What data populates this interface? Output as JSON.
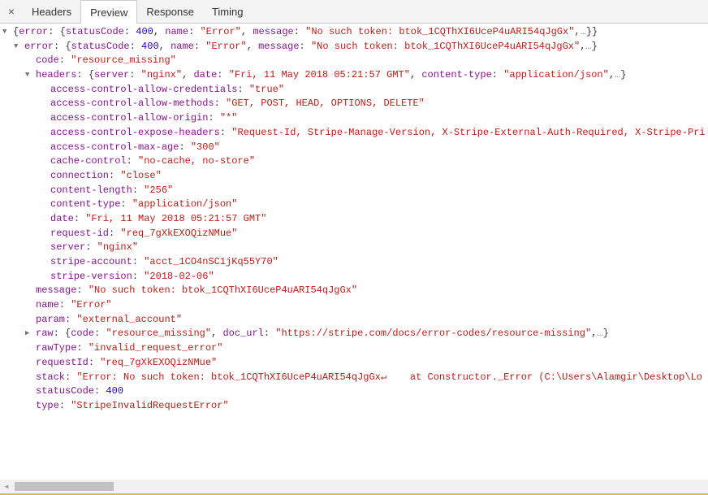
{
  "tabs": {
    "close_icon": "×",
    "items": [
      {
        "label": "Headers",
        "selected": false
      },
      {
        "label": "Preview",
        "selected": true
      },
      {
        "label": "Response",
        "selected": false
      },
      {
        "label": "Timing",
        "selected": false
      }
    ]
  },
  "colors": {
    "key": "#881391",
    "string": "#c41a16",
    "number": "#1c00cf",
    "punct": "#303942",
    "ellipsis": "#888888",
    "triangle": "#727272",
    "tabbar_bg": "#f3f3f3",
    "border": "#cccccc",
    "tab_text": "#333333",
    "scroll_track": "#f1f1f1",
    "scroll_thumb": "#c1c1c1",
    "bottom_line": "#ddb852"
  },
  "scrollbar": {
    "left_arrow": "◄"
  },
  "tree": {
    "rows": [
      {
        "l": 0,
        "a": "d",
        "s": [
          {
            "c": "p",
            "t": "{"
          },
          {
            "c": "k",
            "t": "error"
          },
          {
            "c": "p",
            "t": ": {"
          },
          {
            "c": "k",
            "t": "statusCode"
          },
          {
            "c": "p",
            "t": ": "
          },
          {
            "c": "n",
            "t": "400"
          },
          {
            "c": "p",
            "t": ", "
          },
          {
            "c": "k",
            "t": "name"
          },
          {
            "c": "p",
            "t": ": "
          },
          {
            "c": "s",
            "t": "\"Error\""
          },
          {
            "c": "p",
            "t": ", "
          },
          {
            "c": "k",
            "t": "message"
          },
          {
            "c": "p",
            "t": ": "
          },
          {
            "c": "s",
            "t": "\"No such token: btok_1CQThXI6UceP4uARI54qJgGx\""
          },
          {
            "c": "p",
            "t": ","
          },
          {
            "c": "e",
            "t": "…"
          },
          {
            "c": "p",
            "t": "}}"
          }
        ]
      },
      {
        "l": 1,
        "a": "d",
        "s": [
          {
            "c": "k",
            "t": "error"
          },
          {
            "c": "p",
            "t": ": {"
          },
          {
            "c": "k",
            "t": "statusCode"
          },
          {
            "c": "p",
            "t": ": "
          },
          {
            "c": "n",
            "t": "400"
          },
          {
            "c": "p",
            "t": ", "
          },
          {
            "c": "k",
            "t": "name"
          },
          {
            "c": "p",
            "t": ": "
          },
          {
            "c": "s",
            "t": "\"Error\""
          },
          {
            "c": "p",
            "t": ", "
          },
          {
            "c": "k",
            "t": "message"
          },
          {
            "c": "p",
            "t": ": "
          },
          {
            "c": "s",
            "t": "\"No such token: btok_1CQThXI6UceP4uARI54qJgGx\""
          },
          {
            "c": "p",
            "t": ","
          },
          {
            "c": "e",
            "t": "…"
          },
          {
            "c": "p",
            "t": "}"
          }
        ]
      },
      {
        "l": 2,
        "a": null,
        "s": [
          {
            "c": "k",
            "t": "code"
          },
          {
            "c": "p",
            "t": ": "
          },
          {
            "c": "s",
            "t": "\"resource_missing\""
          }
        ]
      },
      {
        "l": 2,
        "a": "d",
        "s": [
          {
            "c": "k",
            "t": "headers"
          },
          {
            "c": "p",
            "t": ": {"
          },
          {
            "c": "k",
            "t": "server"
          },
          {
            "c": "p",
            "t": ": "
          },
          {
            "c": "s",
            "t": "\"nginx\""
          },
          {
            "c": "p",
            "t": ", "
          },
          {
            "c": "k",
            "t": "date"
          },
          {
            "c": "p",
            "t": ": "
          },
          {
            "c": "s",
            "t": "\"Fri, 11 May 2018 05:21:57 GMT\""
          },
          {
            "c": "p",
            "t": ", "
          },
          {
            "c": "k",
            "t": "content-type"
          },
          {
            "c": "p",
            "t": ": "
          },
          {
            "c": "s",
            "t": "\"application/json\""
          },
          {
            "c": "p",
            "t": ","
          },
          {
            "c": "e",
            "t": "…"
          },
          {
            "c": "p",
            "t": "}"
          }
        ]
      },
      {
        "l": 3,
        "a": null,
        "s": [
          {
            "c": "k",
            "t": "access-control-allow-credentials"
          },
          {
            "c": "p",
            "t": ": "
          },
          {
            "c": "s",
            "t": "\"true\""
          }
        ]
      },
      {
        "l": 3,
        "a": null,
        "s": [
          {
            "c": "k",
            "t": "access-control-allow-methods"
          },
          {
            "c": "p",
            "t": ": "
          },
          {
            "c": "s",
            "t": "\"GET, POST, HEAD, OPTIONS, DELETE\""
          }
        ]
      },
      {
        "l": 3,
        "a": null,
        "s": [
          {
            "c": "k",
            "t": "access-control-allow-origin"
          },
          {
            "c": "p",
            "t": ": "
          },
          {
            "c": "s",
            "t": "\"*\""
          }
        ]
      },
      {
        "l": 3,
        "a": null,
        "s": [
          {
            "c": "k",
            "t": "access-control-expose-headers"
          },
          {
            "c": "p",
            "t": ": "
          },
          {
            "c": "s",
            "t": "\"Request-Id, Stripe-Manage-Version, X-Stripe-External-Auth-Required, X-Stripe-Pri"
          }
        ]
      },
      {
        "l": 3,
        "a": null,
        "s": [
          {
            "c": "k",
            "t": "access-control-max-age"
          },
          {
            "c": "p",
            "t": ": "
          },
          {
            "c": "s",
            "t": "\"300\""
          }
        ]
      },
      {
        "l": 3,
        "a": null,
        "s": [
          {
            "c": "k",
            "t": "cache-control"
          },
          {
            "c": "p",
            "t": ": "
          },
          {
            "c": "s",
            "t": "\"no-cache, no-store\""
          }
        ]
      },
      {
        "l": 3,
        "a": null,
        "s": [
          {
            "c": "k",
            "t": "connection"
          },
          {
            "c": "p",
            "t": ": "
          },
          {
            "c": "s",
            "t": "\"close\""
          }
        ]
      },
      {
        "l": 3,
        "a": null,
        "s": [
          {
            "c": "k",
            "t": "content-length"
          },
          {
            "c": "p",
            "t": ": "
          },
          {
            "c": "s",
            "t": "\"256\""
          }
        ]
      },
      {
        "l": 3,
        "a": null,
        "s": [
          {
            "c": "k",
            "t": "content-type"
          },
          {
            "c": "p",
            "t": ": "
          },
          {
            "c": "s",
            "t": "\"application/json\""
          }
        ]
      },
      {
        "l": 3,
        "a": null,
        "s": [
          {
            "c": "k",
            "t": "date"
          },
          {
            "c": "p",
            "t": ": "
          },
          {
            "c": "s",
            "t": "\"Fri, 11 May 2018 05:21:57 GMT\""
          }
        ]
      },
      {
        "l": 3,
        "a": null,
        "s": [
          {
            "c": "k",
            "t": "request-id"
          },
          {
            "c": "p",
            "t": ": "
          },
          {
            "c": "s",
            "t": "\"req_7gXkEXOQizNMue\""
          }
        ]
      },
      {
        "l": 3,
        "a": null,
        "s": [
          {
            "c": "k",
            "t": "server"
          },
          {
            "c": "p",
            "t": ": "
          },
          {
            "c": "s",
            "t": "\"nginx\""
          }
        ]
      },
      {
        "l": 3,
        "a": null,
        "s": [
          {
            "c": "k",
            "t": "stripe-account"
          },
          {
            "c": "p",
            "t": ": "
          },
          {
            "c": "s",
            "t": "\"acct_1CO4nSC1jKq55Y70\""
          }
        ]
      },
      {
        "l": 3,
        "a": null,
        "s": [
          {
            "c": "k",
            "t": "stripe-version"
          },
          {
            "c": "p",
            "t": ": "
          },
          {
            "c": "s",
            "t": "\"2018-02-06\""
          }
        ]
      },
      {
        "l": 2,
        "a": null,
        "s": [
          {
            "c": "k",
            "t": "message"
          },
          {
            "c": "p",
            "t": ": "
          },
          {
            "c": "s",
            "t": "\"No such token: btok_1CQThXI6UceP4uARI54qJgGx\""
          }
        ]
      },
      {
        "l": 2,
        "a": null,
        "s": [
          {
            "c": "k",
            "t": "name"
          },
          {
            "c": "p",
            "t": ": "
          },
          {
            "c": "s",
            "t": "\"Error\""
          }
        ]
      },
      {
        "l": 2,
        "a": null,
        "s": [
          {
            "c": "k",
            "t": "param"
          },
          {
            "c": "p",
            "t": ": "
          },
          {
            "c": "s",
            "t": "\"external_account\""
          }
        ]
      },
      {
        "l": 2,
        "a": "r",
        "s": [
          {
            "c": "k",
            "t": "raw"
          },
          {
            "c": "p",
            "t": ": {"
          },
          {
            "c": "k",
            "t": "code"
          },
          {
            "c": "p",
            "t": ": "
          },
          {
            "c": "s",
            "t": "\"resource_missing\""
          },
          {
            "c": "p",
            "t": ", "
          },
          {
            "c": "k",
            "t": "doc_url"
          },
          {
            "c": "p",
            "t": ": "
          },
          {
            "c": "s",
            "t": "\"https://stripe.com/docs/error-codes/resource-missing\""
          },
          {
            "c": "p",
            "t": ","
          },
          {
            "c": "e",
            "t": "…"
          },
          {
            "c": "p",
            "t": "}"
          }
        ]
      },
      {
        "l": 2,
        "a": null,
        "s": [
          {
            "c": "k",
            "t": "rawType"
          },
          {
            "c": "p",
            "t": ": "
          },
          {
            "c": "s",
            "t": "\"invalid_request_error\""
          }
        ]
      },
      {
        "l": 2,
        "a": null,
        "s": [
          {
            "c": "k",
            "t": "requestId"
          },
          {
            "c": "p",
            "t": ": "
          },
          {
            "c": "s",
            "t": "\"req_7gXkEXOQizNMue\""
          }
        ]
      },
      {
        "l": 2,
        "a": null,
        "s": [
          {
            "c": "k",
            "t": "stack"
          },
          {
            "c": "p",
            "t": ": "
          },
          {
            "c": "s",
            "t": "\"Error: No such token: btok_1CQThXI6UceP4uARI54qJgGx↵    at Constructor._Error (C:\\Users\\Alamgir\\Desktop\\Lo"
          }
        ]
      },
      {
        "l": 2,
        "a": null,
        "s": [
          {
            "c": "k",
            "t": "statusCode"
          },
          {
            "c": "p",
            "t": ": "
          },
          {
            "c": "n",
            "t": "400"
          }
        ]
      },
      {
        "l": 2,
        "a": null,
        "s": [
          {
            "c": "k",
            "t": "type"
          },
          {
            "c": "p",
            "t": ": "
          },
          {
            "c": "s",
            "t": "\"StripeInvalidRequestError\""
          }
        ]
      }
    ]
  }
}
